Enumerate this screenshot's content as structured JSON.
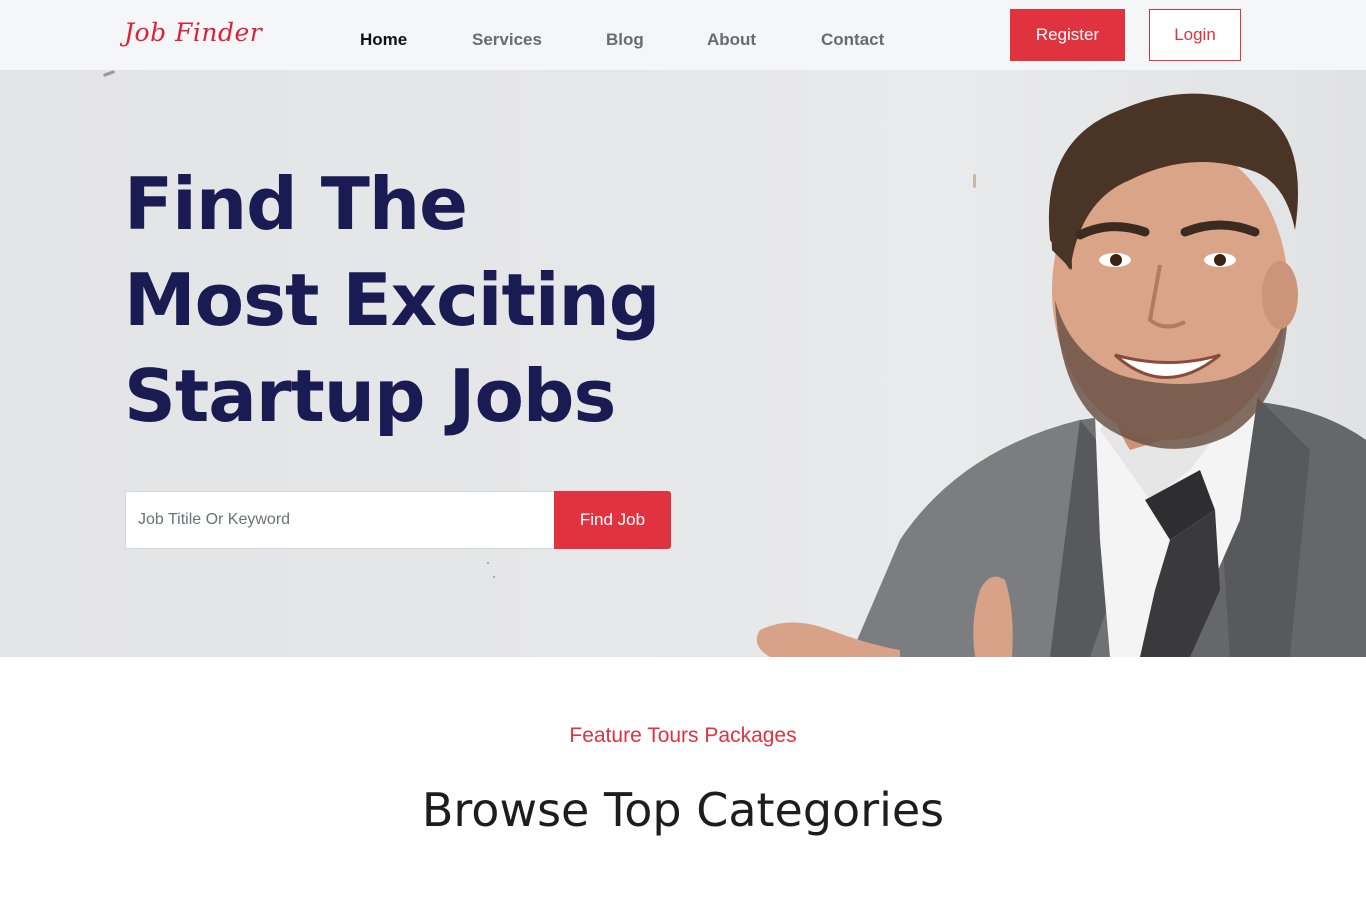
{
  "header": {
    "logo": "Job Finder",
    "nav": [
      {
        "label": "Home",
        "active": true
      },
      {
        "label": "Services",
        "active": false
      },
      {
        "label": "Blog",
        "active": false
      },
      {
        "label": "About",
        "active": false
      },
      {
        "label": "Contact",
        "active": false
      }
    ],
    "register_label": "Register",
    "login_label": "Login"
  },
  "hero": {
    "title_lines": [
      "Find The",
      "Most Exciting",
      "Startup Jobs"
    ],
    "search_placeholder": "Job Titile Or Keyword",
    "search_value": "",
    "search_button_label": "Find Job",
    "image": "smiling-businessman-photo"
  },
  "section": {
    "subtitle": "Feature Tours Packages",
    "title": "Browse Top Categories"
  },
  "colors": {
    "accent": "#e1323f",
    "title_navy": "#1b1b53",
    "header_bg": "#f5f6f8",
    "hero_bg": "#e5e6e8"
  }
}
